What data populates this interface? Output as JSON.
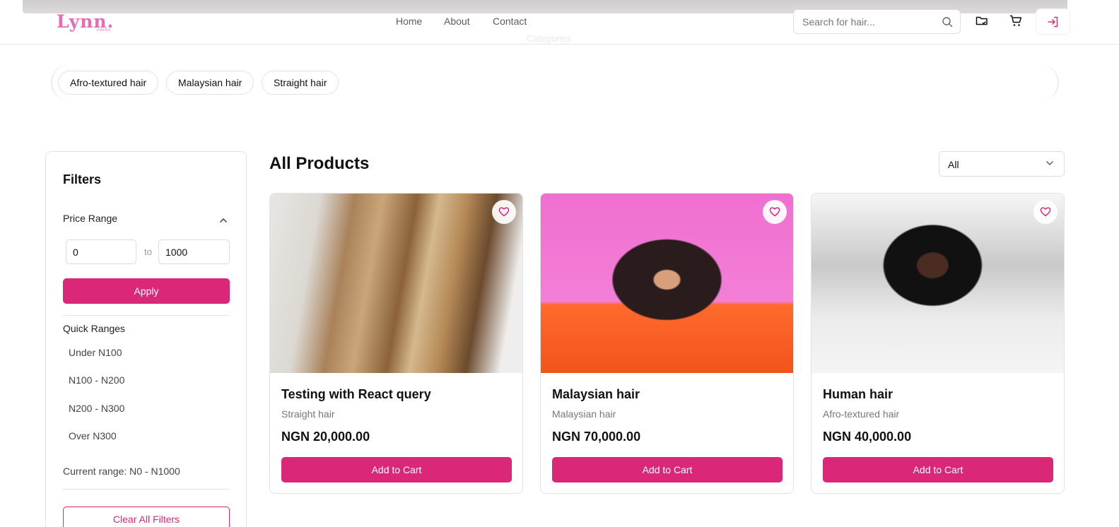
{
  "brand": {
    "name": "Lynn.",
    "sub": "HAIRS"
  },
  "nav": {
    "home": "Home",
    "about": "About",
    "contact": "Contact"
  },
  "faded_heading": "Categories",
  "search": {
    "placeholder": "Search for hair...",
    "value": ""
  },
  "categories": [
    "Afro-textured hair",
    "Malaysian hair",
    "Straight hair"
  ],
  "filters": {
    "title": "Filters",
    "price_range_label": "Price Range",
    "min_value": "0",
    "to_label": "to",
    "max_value": "1000",
    "apply_label": "Apply",
    "quick_ranges_label": "Quick Ranges",
    "quick_ranges": [
      "Under N100",
      "N100 - N200",
      "N200 - N300",
      "Over N300"
    ],
    "current_range": "Current range: N0 - N1000",
    "clear_label": "Clear All Filters"
  },
  "products": {
    "heading": "All Products",
    "sort_value": "All",
    "items": [
      {
        "name": "Testing with React query",
        "category": "Straight hair",
        "price": "NGN 20,000.00",
        "button": "Add to Cart"
      },
      {
        "name": "Malaysian hair",
        "category": "Malaysian hair",
        "price": "NGN 70,000.00",
        "button": "Add to Cart"
      },
      {
        "name": "Human hair",
        "category": "Afro-textured hair",
        "price": "NGN 40,000.00",
        "button": "Add to Cart"
      }
    ]
  },
  "colors": {
    "accent": "#db2777",
    "logo": "#e86bb5"
  },
  "icons": [
    "search-icon",
    "folder-icon",
    "cart-icon",
    "login-icon",
    "chevron-up-icon",
    "chevron-down-icon",
    "heart-icon"
  ]
}
